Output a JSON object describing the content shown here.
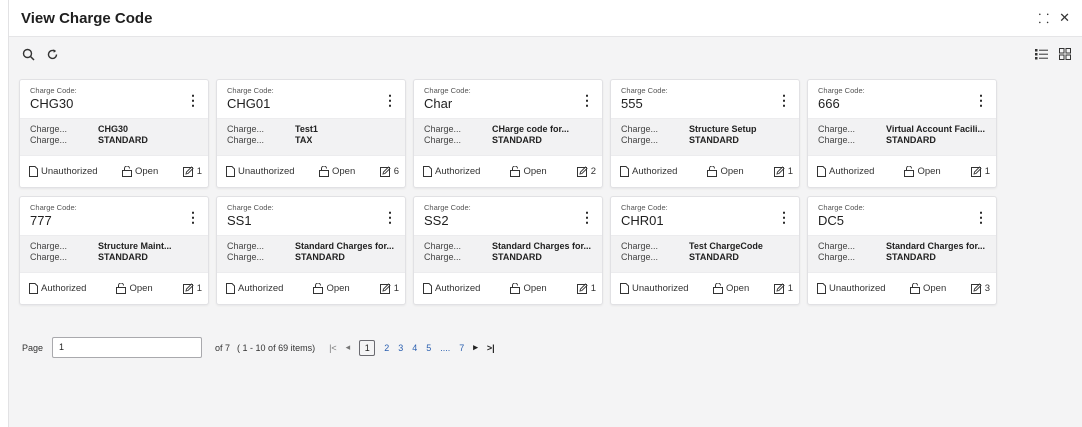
{
  "window": {
    "title": "View Charge Code",
    "expand_icon": "expand-icon",
    "close_icon": "close-icon",
    "expand_glyph": "⸬",
    "close_glyph": "✕"
  },
  "toolbar": {
    "search_icon": "search-icon",
    "refresh_icon": "refresh-icon",
    "list_view_icon": "list-view-icon",
    "grid_view_icon": "grid-view-icon"
  },
  "card_label": "Charge Code:",
  "cards": [
    {
      "code": "CHG30",
      "row1_key": "Charge...",
      "row1_val": "CHG30",
      "row2_key": "Charge...",
      "row2_val": "STANDARD",
      "status": "Unauthorized",
      "open": "Open",
      "count": "1"
    },
    {
      "code": "CHG01",
      "row1_key": "Charge...",
      "row1_val": "Test1",
      "row2_key": "Charge...",
      "row2_val": "TAX",
      "status": "Unauthorized",
      "open": "Open",
      "count": "6"
    },
    {
      "code": "Char",
      "row1_key": "Charge...",
      "row1_val": "CHarge code for...",
      "row2_key": "Charge...",
      "row2_val": "STANDARD",
      "status": "Authorized",
      "open": "Open",
      "count": "2"
    },
    {
      "code": "555",
      "row1_key": "Charge...",
      "row1_val": "Structure Setup",
      "row2_key": "Charge...",
      "row2_val": "STANDARD",
      "status": "Authorized",
      "open": "Open",
      "count": "1"
    },
    {
      "code": "666",
      "row1_key": "Charge...",
      "row1_val": "Virtual Account Facili...",
      "row2_key": "Charge...",
      "row2_val": "STANDARD",
      "status": "Authorized",
      "open": "Open",
      "count": "1"
    },
    {
      "code": "777",
      "row1_key": "Charge...",
      "row1_val": "Structure Maint...",
      "row2_key": "Charge...",
      "row2_val": "STANDARD",
      "status": "Authorized",
      "open": "Open",
      "count": "1"
    },
    {
      "code": "SS1",
      "row1_key": "Charge...",
      "row1_val": "Standard Charges for...",
      "row2_key": "Charge...",
      "row2_val": "STANDARD",
      "status": "Authorized",
      "open": "Open",
      "count": "1"
    },
    {
      "code": "SS2",
      "row1_key": "Charge...",
      "row1_val": "Standard Charges for...",
      "row2_key": "Charge...",
      "row2_val": "STANDARD",
      "status": "Authorized",
      "open": "Open",
      "count": "1"
    },
    {
      "code": "CHR01",
      "row1_key": "Charge...",
      "row1_val": "Test ChargeCode",
      "row2_key": "Charge...",
      "row2_val": "STANDARD",
      "status": "Unauthorized",
      "open": "Open",
      "count": "1"
    },
    {
      "code": "DC5",
      "row1_key": "Charge...",
      "row1_val": "Standard Charges for...",
      "row2_key": "Charge...",
      "row2_val": "STANDARD",
      "status": "Unauthorized",
      "open": "Open",
      "count": "3"
    }
  ],
  "pagination": {
    "page_label": "Page",
    "page_value": "1",
    "of_text": "of 7",
    "items_text": "( 1 - 10 of 69 items)",
    "first_glyph": "|<",
    "prev_glyph": "◂",
    "next_glyph": "▸",
    "last_glyph": ">|",
    "current": "1",
    "pages": [
      "2",
      "3",
      "4",
      "5",
      "....",
      "7"
    ]
  }
}
